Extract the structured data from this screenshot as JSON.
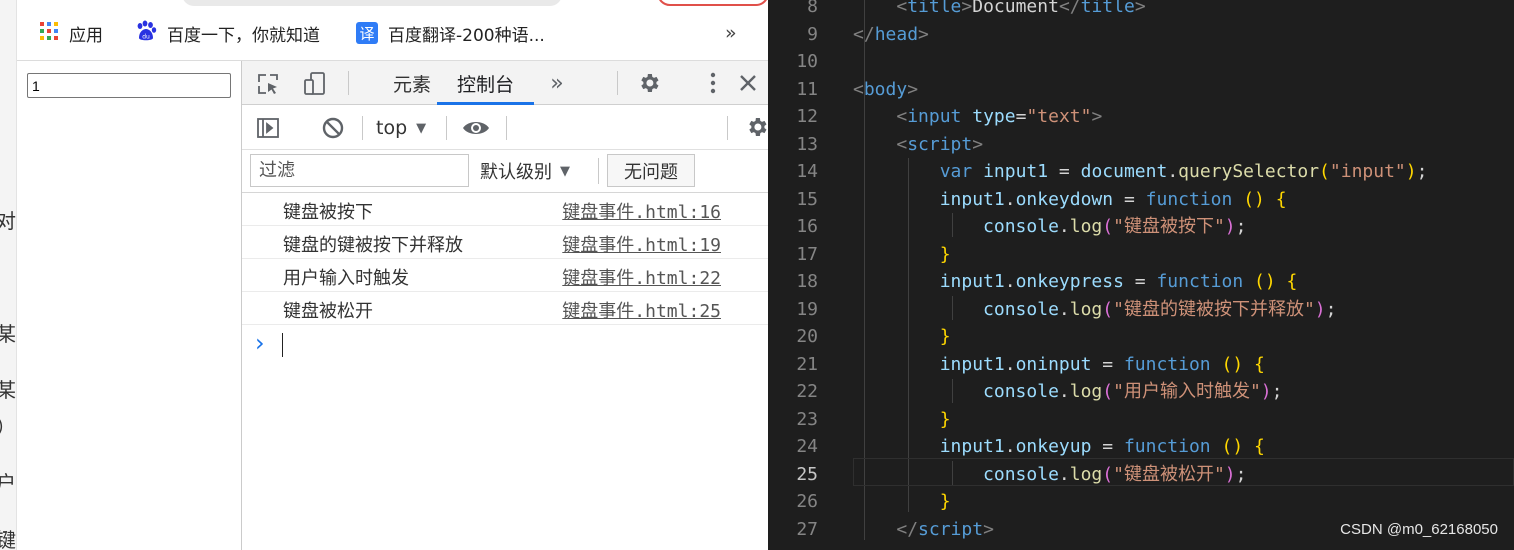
{
  "bookmarks": [
    {
      "label": "应用",
      "icon": "apps-grid-icon"
    },
    {
      "label": "百度一下，你就知道",
      "icon": "baidu-paw-icon"
    },
    {
      "label": "百度翻译-200种语...",
      "icon": "translate-icon",
      "icon_text": "译"
    },
    {
      "label": "»",
      "icon": "chevron-more-icon"
    }
  ],
  "page": {
    "input_value": "1"
  },
  "left_strip_chars": [
    "对",
    "某",
    "某",
    "）",
    "户",
    "键"
  ],
  "devtools": {
    "tabs": [
      {
        "label": "元素"
      },
      {
        "label": "控制台",
        "active": true
      },
      {
        "label": "»"
      }
    ],
    "context": "top",
    "filter_placeholder": "过滤",
    "level_label": "默认级别",
    "issues_label": "无问题",
    "messages": [
      {
        "text": "键盘被按下",
        "source": "键盘事件.html:16"
      },
      {
        "text": "键盘的键被按下并释放",
        "source": "键盘事件.html:19"
      },
      {
        "text": "用户输入时触发",
        "source": "键盘事件.html:22"
      },
      {
        "text": "键盘被松开",
        "source": "键盘事件.html:25"
      }
    ],
    "prompt_symbol": "›"
  },
  "editor": {
    "active_line": 25,
    "lines": [
      {
        "n": "8",
        "tokens": [
          [
            "    ",
            "tx"
          ],
          [
            "<",
            "br"
          ],
          [
            "title",
            "tg"
          ],
          [
            ">",
            "br"
          ],
          [
            "Document",
            "tx"
          ],
          [
            "</",
            "br"
          ],
          [
            "title",
            "tg"
          ],
          [
            ">",
            "br"
          ]
        ]
      },
      {
        "n": "9",
        "tokens": [
          [
            "</",
            "br"
          ],
          [
            "head",
            "tg"
          ],
          [
            ">",
            "br"
          ]
        ]
      },
      {
        "n": "10",
        "tokens": []
      },
      {
        "n": "11",
        "tokens": [
          [
            "<",
            "br"
          ],
          [
            "body",
            "tg"
          ],
          [
            ">",
            "br"
          ]
        ]
      },
      {
        "n": "12",
        "tokens": [
          [
            "    ",
            "tx"
          ],
          [
            "<",
            "br"
          ],
          [
            "input",
            "tg"
          ],
          [
            " ",
            "tx"
          ],
          [
            "type",
            "at"
          ],
          [
            "=",
            "tx"
          ],
          [
            "\"text\"",
            "st"
          ],
          [
            ">",
            "br"
          ]
        ]
      },
      {
        "n": "13",
        "tokens": [
          [
            "    ",
            "tx"
          ],
          [
            "<",
            "br"
          ],
          [
            "script",
            "tg"
          ],
          [
            ">",
            "br"
          ]
        ]
      },
      {
        "n": "14",
        "tokens": [
          [
            "        ",
            "tx"
          ],
          [
            "var",
            "kw"
          ],
          [
            " ",
            "tx"
          ],
          [
            "input1",
            "vr"
          ],
          [
            " = ",
            "tx"
          ],
          [
            "document",
            "vr"
          ],
          [
            ".",
            "tx"
          ],
          [
            "querySelector",
            "fn"
          ],
          [
            "(",
            "p1"
          ],
          [
            "\"input\"",
            "st"
          ],
          [
            ")",
            "p1"
          ],
          [
            ";",
            "tx"
          ]
        ]
      },
      {
        "n": "15",
        "tokens": [
          [
            "        ",
            "tx"
          ],
          [
            "input1",
            "vr"
          ],
          [
            ".",
            "tx"
          ],
          [
            "onkeydown",
            "vr"
          ],
          [
            " = ",
            "tx"
          ],
          [
            "function",
            "kw"
          ],
          [
            " ",
            "tx"
          ],
          [
            "()",
            "p1"
          ],
          [
            " ",
            "tx"
          ],
          [
            "{",
            "p1"
          ]
        ]
      },
      {
        "n": "16",
        "tokens": [
          [
            "            ",
            "tx"
          ],
          [
            "console",
            "vr"
          ],
          [
            ".",
            "tx"
          ],
          [
            "log",
            "fn"
          ],
          [
            "(",
            "p2"
          ],
          [
            "\"键盘被按下\"",
            "st"
          ],
          [
            ")",
            "p2"
          ],
          [
            ";",
            "tx"
          ]
        ]
      },
      {
        "n": "17",
        "tokens": [
          [
            "        ",
            "tx"
          ],
          [
            "}",
            "p1"
          ]
        ]
      },
      {
        "n": "18",
        "tokens": [
          [
            "        ",
            "tx"
          ],
          [
            "input1",
            "vr"
          ],
          [
            ".",
            "tx"
          ],
          [
            "onkeypress",
            "vr"
          ],
          [
            " = ",
            "tx"
          ],
          [
            "function",
            "kw"
          ],
          [
            " ",
            "tx"
          ],
          [
            "()",
            "p1"
          ],
          [
            " ",
            "tx"
          ],
          [
            "{",
            "p1"
          ]
        ]
      },
      {
        "n": "19",
        "tokens": [
          [
            "            ",
            "tx"
          ],
          [
            "console",
            "vr"
          ],
          [
            ".",
            "tx"
          ],
          [
            "log",
            "fn"
          ],
          [
            "(",
            "p2"
          ],
          [
            "\"键盘的键被按下并释放\"",
            "st"
          ],
          [
            ")",
            "p2"
          ],
          [
            ";",
            "tx"
          ]
        ]
      },
      {
        "n": "20",
        "tokens": [
          [
            "        ",
            "tx"
          ],
          [
            "}",
            "p1"
          ]
        ]
      },
      {
        "n": "21",
        "tokens": [
          [
            "        ",
            "tx"
          ],
          [
            "input1",
            "vr"
          ],
          [
            ".",
            "tx"
          ],
          [
            "oninput",
            "vr"
          ],
          [
            " = ",
            "tx"
          ],
          [
            "function",
            "kw"
          ],
          [
            " ",
            "tx"
          ],
          [
            "()",
            "p1"
          ],
          [
            " ",
            "tx"
          ],
          [
            "{",
            "p1"
          ]
        ]
      },
      {
        "n": "22",
        "tokens": [
          [
            "            ",
            "tx"
          ],
          [
            "console",
            "vr"
          ],
          [
            ".",
            "tx"
          ],
          [
            "log",
            "fn"
          ],
          [
            "(",
            "p2"
          ],
          [
            "\"用户输入时触发\"",
            "st"
          ],
          [
            ")",
            "p2"
          ],
          [
            ";",
            "tx"
          ]
        ]
      },
      {
        "n": "23",
        "tokens": [
          [
            "        ",
            "tx"
          ],
          [
            "}",
            "p1"
          ]
        ]
      },
      {
        "n": "24",
        "tokens": [
          [
            "        ",
            "tx"
          ],
          [
            "input1",
            "vr"
          ],
          [
            ".",
            "tx"
          ],
          [
            "onkeyup",
            "vr"
          ],
          [
            " = ",
            "tx"
          ],
          [
            "function",
            "kw"
          ],
          [
            " ",
            "tx"
          ],
          [
            "()",
            "p1"
          ],
          [
            " ",
            "tx"
          ],
          [
            "{",
            "p1"
          ]
        ]
      },
      {
        "n": "25",
        "tokens": [
          [
            "            ",
            "tx"
          ],
          [
            "console",
            "vr"
          ],
          [
            ".",
            "tx"
          ],
          [
            "log",
            "fn"
          ],
          [
            "(",
            "p2"
          ],
          [
            "\"键盘被松开\"",
            "st"
          ],
          [
            ")",
            "p2"
          ],
          [
            ";",
            "tx"
          ]
        ]
      },
      {
        "n": "26",
        "tokens": [
          [
            "        ",
            "tx"
          ],
          [
            "}",
            "p1"
          ]
        ]
      },
      {
        "n": "27",
        "tokens": [
          [
            "    ",
            "tx"
          ],
          [
            "</",
            "br"
          ],
          [
            "script",
            "tg"
          ],
          [
            ">",
            "br"
          ]
        ]
      }
    ]
  },
  "watermark": "CSDN @m0_62168050",
  "colors": {
    "editor_bg": "#1e1e1e",
    "tab_active_underline": "#1a73e8",
    "tag": "#569cd6",
    "string": "#ce9178",
    "variable": "#9cdcfe",
    "function_name": "#dcdcaa"
  }
}
